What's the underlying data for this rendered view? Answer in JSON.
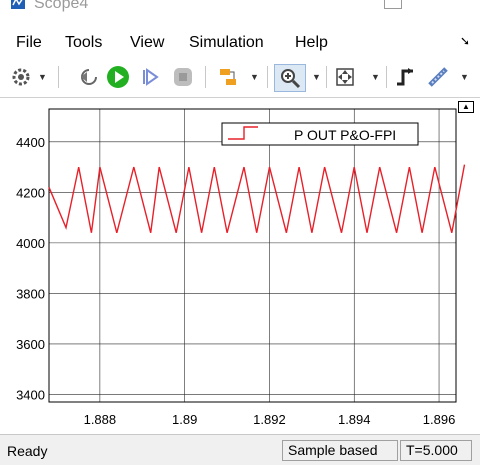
{
  "window": {
    "title": "Scope4"
  },
  "menu": {
    "items": [
      "File",
      "Tools",
      "View",
      "Simulation",
      "Help"
    ],
    "dock_icon": "dock-arrow-icon"
  },
  "toolbar": {
    "icons": [
      "gear-icon",
      "step-back-icon",
      "run-icon",
      "step-forward-icon",
      "stop-icon",
      "signal-selector-icon",
      "zoom-in-icon",
      "fit-view-icon",
      "triggers-icon",
      "cursor-measure-icon"
    ]
  },
  "colors": {
    "signal": "#e8202a",
    "run_green": "#22b022",
    "grid": "#2a2a2a"
  },
  "chart_data": {
    "type": "line",
    "series": [
      {
        "name": "P OUT P&O-FPI",
        "x": [
          1.8868,
          1.8872,
          1.8875,
          1.8878,
          1.888,
          1.8884,
          1.8888,
          1.8892,
          1.8894,
          1.8898,
          1.8901,
          1.8904,
          1.8907,
          1.891,
          1.8914,
          1.8917,
          1.892,
          1.8924,
          1.8927,
          1.893,
          1.8933,
          1.8937,
          1.894,
          1.8943,
          1.8946,
          1.895,
          1.8953,
          1.8956,
          1.8959,
          1.8963,
          1.8966
        ],
        "y": [
          4220,
          4060,
          4300,
          4040,
          4300,
          4040,
          4300,
          4040,
          4300,
          4040,
          4300,
          4040,
          4300,
          4040,
          4300,
          4040,
          4300,
          4040,
          4300,
          4040,
          4300,
          4040,
          4300,
          4040,
          4300,
          4040,
          4300,
          4040,
          4300,
          4040,
          4310
        ]
      }
    ],
    "xlim": [
      1.8868,
      1.8964
    ],
    "ylim": [
      3370,
      4530
    ],
    "xticks": [
      "1.888",
      "1.89",
      "1.892",
      "1.894",
      "1.896"
    ],
    "xtick_values": [
      1.888,
      1.89,
      1.892,
      1.894,
      1.896
    ],
    "yticks": [
      "4400",
      "4200",
      "4000",
      "3800",
      "3600",
      "3400"
    ],
    "ytick_values": [
      4400,
      4200,
      4000,
      3800,
      3600,
      3400
    ],
    "grid": true,
    "legend_position": "top-right"
  },
  "status": {
    "ready": "Ready",
    "mode": "Sample based",
    "time": "T=5.000"
  }
}
